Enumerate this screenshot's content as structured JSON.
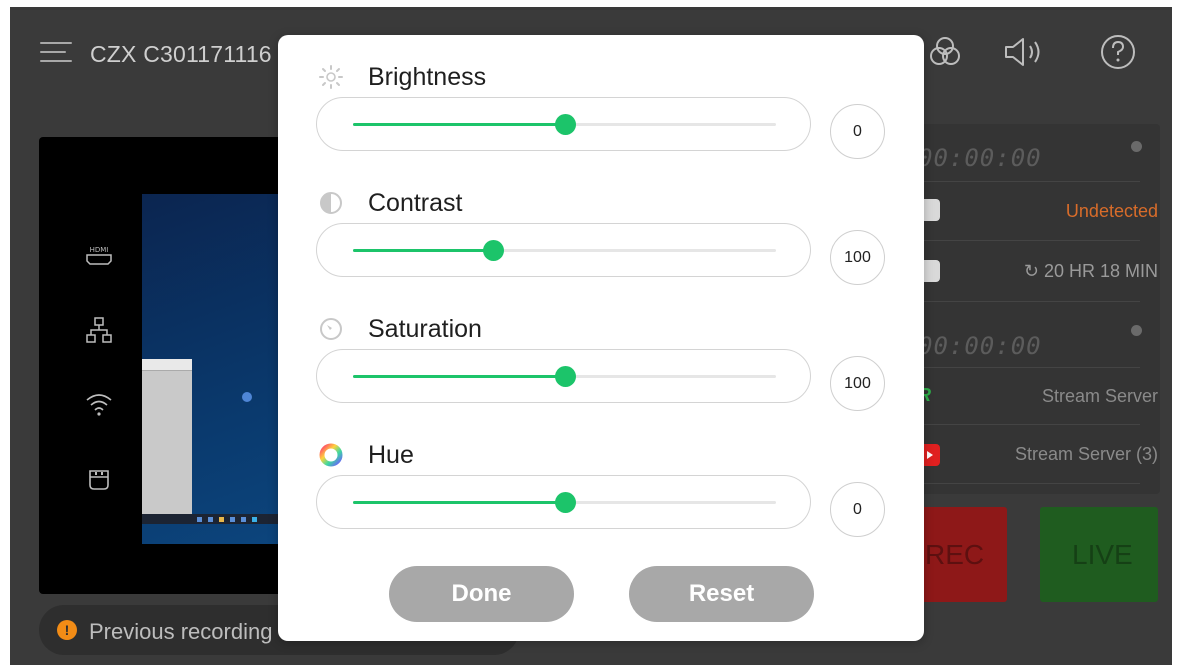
{
  "header": {
    "device_name": "CZX C301171116",
    "icons": [
      "menu-icon",
      "color-adjust-icon",
      "volume-icon",
      "help-icon"
    ]
  },
  "sidebar_icons": [
    "hdmi-in-icon",
    "network-icon",
    "wifi-icon",
    "usb-icon"
  ],
  "right_panel": {
    "record_timer": "00:00:00",
    "storage_status": "Undetected",
    "storage_status_color": "#d86c2a",
    "remaining_time": "20 HR 18 MIN",
    "stream_timer": "00:00:00",
    "stream_server_1": "Stream Server",
    "stream_server_2": "Stream Server (3)"
  },
  "buttons": {
    "rec": "REC",
    "live": "LIVE"
  },
  "notice": {
    "text": "Previous recording error detected"
  },
  "dialog": {
    "controls": [
      {
        "label": "Brightness",
        "value": "0",
        "level": 0.5,
        "icon": "brightness-icon"
      },
      {
        "label": "Contrast",
        "value": "100",
        "level": 0.33,
        "icon": "contrast-icon"
      },
      {
        "label": "Saturation",
        "value": "100",
        "level": 0.5,
        "icon": "saturation-icon"
      },
      {
        "label": "Hue",
        "value": "0",
        "level": 0.5,
        "icon": "hue-icon"
      }
    ],
    "done_label": "Done",
    "reset_label": "Reset",
    "accent_color": "#1cc46a"
  }
}
